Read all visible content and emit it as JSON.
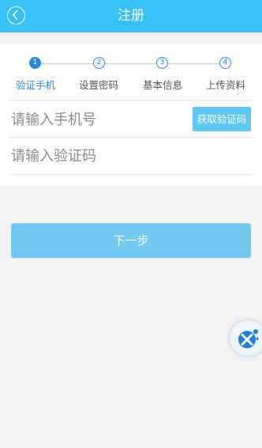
{
  "header": {
    "title": "注册",
    "back_icon": "back-chevron-icon"
  },
  "steps": [
    {
      "number": "1",
      "label": "验证手机",
      "active": true
    },
    {
      "number": "2",
      "label": "设置密码",
      "active": false
    },
    {
      "number": "3",
      "label": "基本信息",
      "active": false
    },
    {
      "number": "4",
      "label": "上传资料",
      "active": false
    }
  ],
  "form": {
    "phone_placeholder": "请输入手机号",
    "code_placeholder": "请输入验证码",
    "get_code_label": "获取验证码"
  },
  "next_label": "下一步",
  "floating_tool_icon": "assistive-touch-icon",
  "colors": {
    "header_bg": "#36c0f5",
    "step_active": "#2b86e0",
    "button_bg": "#73c9f0"
  }
}
